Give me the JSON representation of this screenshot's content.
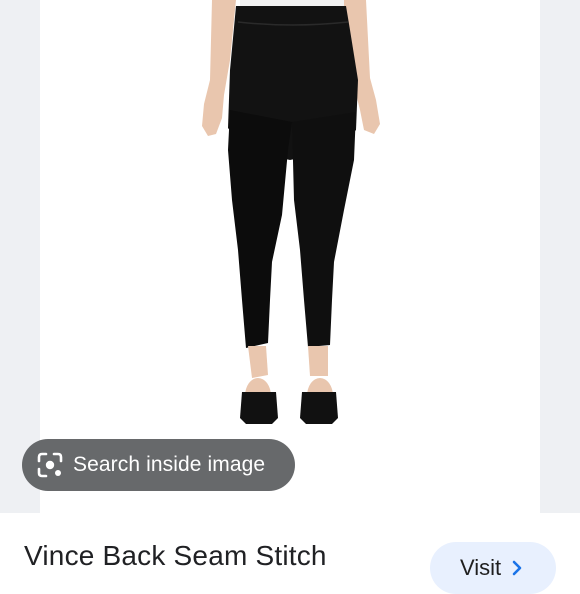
{
  "product": {
    "title": "Vince Back Seam Stitch",
    "image_icon": "leggings-product-photo"
  },
  "lens": {
    "label": "Search inside image",
    "icon": "lens-camera-icon"
  },
  "actions": {
    "visit_label": "Visit",
    "visit_icon": "chevron-right-icon"
  },
  "colors": {
    "accent": "#1a73e8",
    "visit_bg": "#e8f0fe",
    "chip_bg": "#525457"
  }
}
